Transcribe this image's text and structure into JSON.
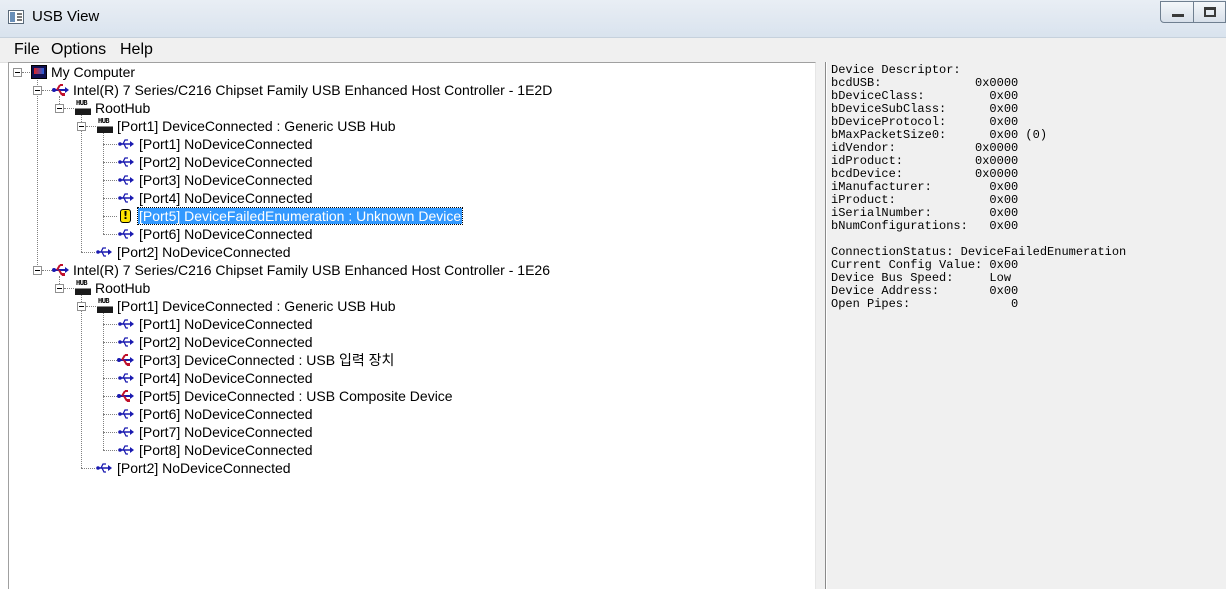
{
  "window": {
    "title": "USB View"
  },
  "menu": {
    "file": "File",
    "options": "Options",
    "help": "Help"
  },
  "tree": {
    "root": "My Computer",
    "controller1": {
      "label": "Intel(R) 7 Series/C216 Chipset Family USB Enhanced Host Controller - 1E2D",
      "roothub": "RootHub",
      "hub_port": "[Port1] DeviceConnected :  Generic USB Hub",
      "ports": [
        "[Port1] NoDeviceConnected",
        "[Port2] NoDeviceConnected",
        "[Port3] NoDeviceConnected",
        "[Port4] NoDeviceConnected",
        "[Port5] DeviceFailedEnumeration :  Unknown Device",
        "[Port6] NoDeviceConnected"
      ],
      "root_port2": "[Port2] NoDeviceConnected"
    },
    "controller2": {
      "label": "Intel(R) 7 Series/C216 Chipset Family USB Enhanced Host Controller - 1E26",
      "roothub": "RootHub",
      "hub_port": "[Port1] DeviceConnected :  Generic USB Hub",
      "ports": [
        "[Port1] NoDeviceConnected",
        "[Port2] NoDeviceConnected",
        "[Port3] DeviceConnected :  USB 입력 장치",
        "[Port4] NoDeviceConnected",
        "[Port5] DeviceConnected :  USB Composite Device",
        "[Port6] NoDeviceConnected",
        "[Port7] NoDeviceConnected",
        "[Port8] NoDeviceConnected"
      ],
      "root_port2": "[Port2] NoDeviceConnected"
    },
    "selected": "[Port5] DeviceFailedEnumeration :  Unknown Device"
  },
  "details": {
    "text": "Device Descriptor:\nbcdUSB:             0x0000\nbDeviceClass:         0x00\nbDeviceSubClass:      0x00\nbDeviceProtocol:      0x00\nbMaxPacketSize0:      0x00 (0)\nidVendor:           0x0000\nidProduct:          0x0000\nbcdDevice:          0x0000\niManufacturer:        0x00\niProduct:             0x00\niSerialNumber:        0x00\nbNumConfigurations:   0x00\n\nConnectionStatus: DeviceFailedEnumeration\nCurrent Config Value: 0x00\nDevice Bus Speed:     Low\nDevice Address:       0x00\nOpen Pipes:              0"
  },
  "icons": {
    "app": "usb-view-app-icon",
    "computer": "computer-icon",
    "controller": "usb-controller-icon",
    "hub": "usb-hub-icon",
    "port": "usb-port-icon",
    "device": "usb-device-icon",
    "warning": "warning-icon"
  },
  "colors": {
    "selection": "#3399ff",
    "usb_blue": "#1a1ab0",
    "usb_red": "#c0102a",
    "warning_yellow": "#ffe400"
  }
}
